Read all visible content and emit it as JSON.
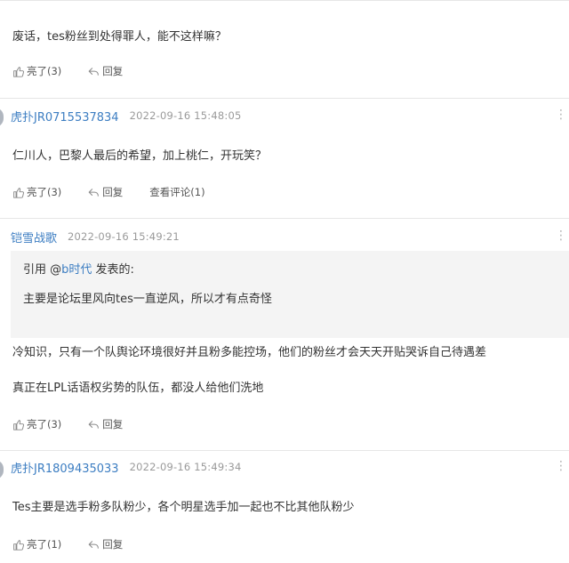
{
  "posts": [
    {
      "content": "废话，tes粉丝到处得罪人，能不这样嘛？",
      "actions": {
        "like": "亮了(3)",
        "reply": "回复"
      }
    },
    {
      "username": "虎扑JR0715537834",
      "time": "2022-09-16 15:48:05",
      "content": "仁川人，巴黎人最后的希望，加上桃仁，开玩笑？",
      "actions": {
        "like": "亮了(3)",
        "reply": "回复",
        "view": "查看评论(1)"
      }
    },
    {
      "username": "铠雪战歌",
      "time": "2022-09-16 15:49:21",
      "quote": {
        "prefix": "引用 @",
        "name": "b时代",
        "suffix": " 发表的:",
        "content": "主要是论坛里风向tes一直逆风，所以才有点奇怪"
      },
      "content_lines": [
        "冷知识，只有一个队舆论环境很好并且粉多能控场，他们的粉丝才会天天开贴哭诉自己待遇差",
        "真正在LPL话语权劣势的队伍，都没人给他们洗地"
      ],
      "actions": {
        "like": "亮了(3)",
        "reply": "回复"
      }
    },
    {
      "username": "虎扑JR1809435033",
      "time": "2022-09-16 15:49:34",
      "content": "Tes主要是选手粉多队粉少，各个明星选手加一起也不比其他队粉少",
      "actions": {
        "like": "亮了(1)",
        "reply": "回复"
      }
    }
  ],
  "icons": {
    "like": "thumbs-up-icon",
    "reply": "reply-arrow-icon",
    "more": "more-dots-icon"
  }
}
